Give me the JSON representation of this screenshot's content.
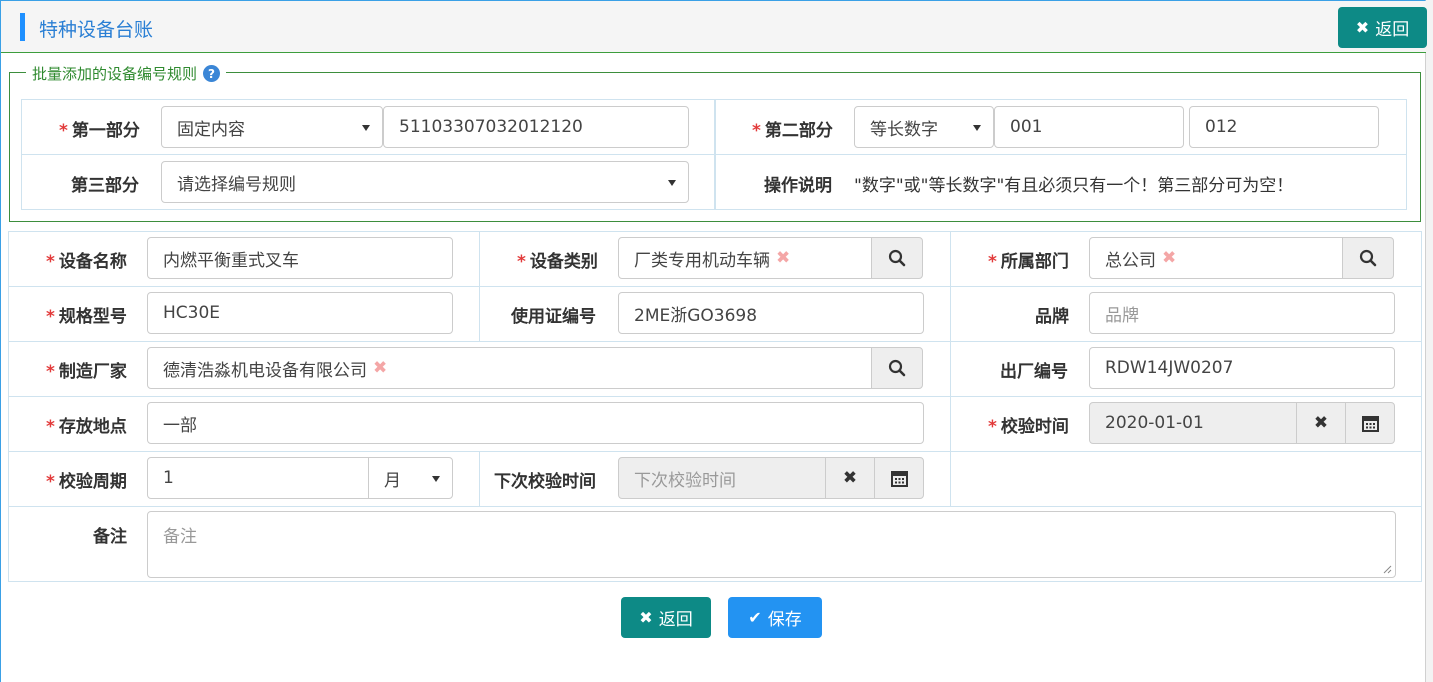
{
  "header": {
    "title": "特种设备台账",
    "back_label": "返回",
    "close_icon": "close-icon"
  },
  "rule_section": {
    "legend": "批量添加的设备编号规则",
    "part1": {
      "label": "第一部分",
      "type_value": "固定内容",
      "content_value": "51103307032012120"
    },
    "part2": {
      "label": "第二部分",
      "type_value": "等长数字",
      "start_value": "001",
      "end_value": "012"
    },
    "part3": {
      "label": "第三部分",
      "placeholder": "请选择编号规则"
    },
    "instructions": {
      "label": "操作说明",
      "text": "\"数字\"或\"等长数字\"有且必须只有一个！第三部分可为空！"
    }
  },
  "form": {
    "device_name": {
      "label": "设备名称",
      "value": "内燃平衡重式叉车"
    },
    "device_category": {
      "label": "设备类别",
      "value": "厂类专用机动车辆"
    },
    "department": {
      "label": "所属部门",
      "value": "总公司"
    },
    "model": {
      "label": "规格型号",
      "value": "HC30E"
    },
    "license_no": {
      "label": "使用证编号",
      "value": "2ME浙GO3698"
    },
    "brand": {
      "label": "品牌",
      "placeholder": "品牌"
    },
    "manufacturer": {
      "label": "制造厂家",
      "value": "德清浩淼机电设备有限公司"
    },
    "factory_no": {
      "label": "出厂编号",
      "value": "RDW14JW0207"
    },
    "location": {
      "label": "存放地点",
      "value": "一部"
    },
    "inspection_date": {
      "label": "校验时间",
      "value": "2020-01-01"
    },
    "inspection_cycle": {
      "label": "校验周期",
      "value": "1",
      "unit": "月"
    },
    "next_inspection": {
      "label": "下次校验时间",
      "placeholder": "下次校验时间"
    },
    "remark": {
      "label": "备注",
      "placeholder": "备注"
    }
  },
  "footer": {
    "back_label": "返回",
    "save_label": "保存"
  },
  "colors": {
    "teal": "#0d8a86",
    "blue": "#2393f2",
    "required": "#e23b3b",
    "title": "#2a7fd4"
  }
}
